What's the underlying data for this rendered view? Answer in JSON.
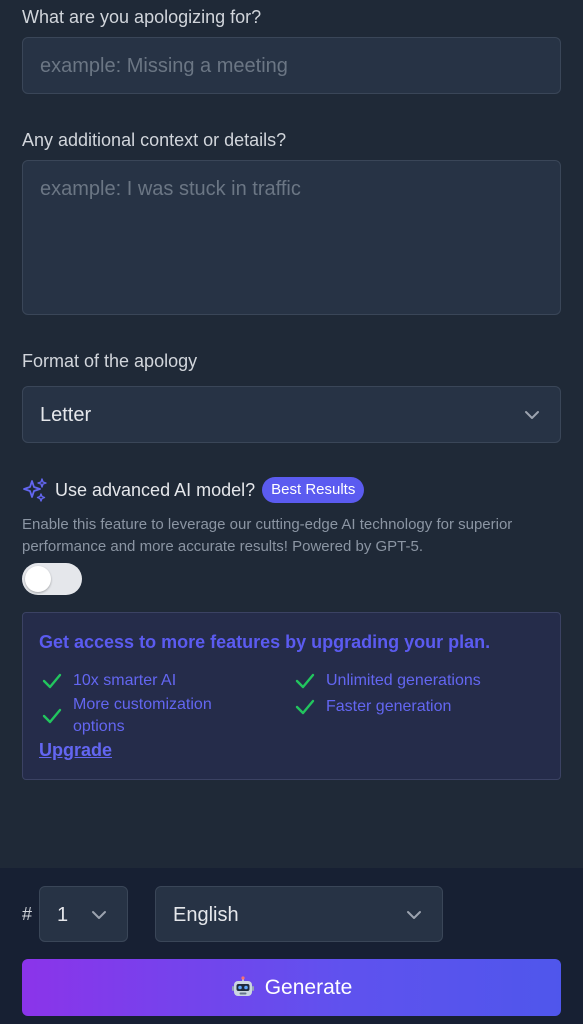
{
  "form": {
    "apology_label": "What are you apologizing for?",
    "apology_placeholder": "example: Missing a meeting",
    "context_label": "Any additional context or details?",
    "context_placeholder": "example: I was stuck in traffic",
    "format_label": "Format of the apology",
    "format_value": "Letter"
  },
  "ai": {
    "label": "Use advanced AI model?",
    "badge": "Best Results",
    "description": "Enable this feature to leverage our cutting-edge AI technology for superior performance and more accurate results! Powered by GPT-5.",
    "enabled": false
  },
  "upgrade": {
    "title": "Get access to more features by upgrading your plan.",
    "features": [
      "10x smarter AI",
      "Unlimited generations",
      "More customization options",
      "Faster generation"
    ],
    "link": "Upgrade"
  },
  "bottom": {
    "hash": "#",
    "count_value": "1",
    "language_value": "English",
    "generate_label": "Generate"
  },
  "colors": {
    "accent": "#5b5bf0",
    "check": "#22c55e",
    "background": "#1f2937"
  }
}
